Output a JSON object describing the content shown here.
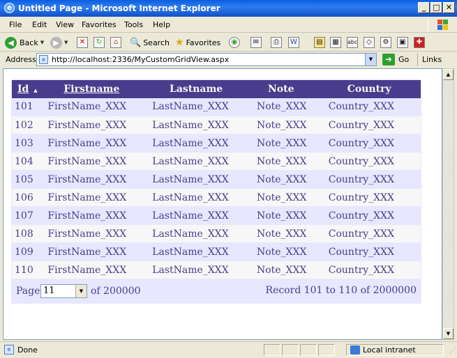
{
  "window": {
    "title": "Untitled Page - Microsoft Internet Explorer",
    "minimize": "_",
    "maximize": "□",
    "close": "✕"
  },
  "menu": [
    "File",
    "Edit",
    "View",
    "Favorites",
    "Tools",
    "Help"
  ],
  "toolbar": {
    "back_label": "Back",
    "search_label": "Search",
    "favorites_label": "Favorites"
  },
  "address": {
    "label": "Address",
    "url": "http://localhost:2336/MyCustomGridView.aspx",
    "go_label": "Go",
    "links_label": "Links"
  },
  "grid": {
    "headers": {
      "id": "Id",
      "sort_indicator": "▲",
      "firstname": "Firstname",
      "lastname": "Lastname",
      "note": "Note",
      "country": "Country"
    },
    "rows": [
      {
        "id": "101",
        "firstname": "FirstName_XXX",
        "lastname": "LastName_XXX",
        "note": "Note_XXX",
        "country": "Country_XXX"
      },
      {
        "id": "102",
        "firstname": "FirstName_XXX",
        "lastname": "LastName_XXX",
        "note": "Note_XXX",
        "country": "Country_XXX"
      },
      {
        "id": "103",
        "firstname": "FirstName_XXX",
        "lastname": "LastName_XXX",
        "note": "Note_XXX",
        "country": "Country_XXX"
      },
      {
        "id": "104",
        "firstname": "FirstName_XXX",
        "lastname": "LastName_XXX",
        "note": "Note_XXX",
        "country": "Country_XXX"
      },
      {
        "id": "105",
        "firstname": "FirstName_XXX",
        "lastname": "LastName_XXX",
        "note": "Note_XXX",
        "country": "Country_XXX"
      },
      {
        "id": "106",
        "firstname": "FirstName_XXX",
        "lastname": "LastName_XXX",
        "note": "Note_XXX",
        "country": "Country_XXX"
      },
      {
        "id": "107",
        "firstname": "FirstName_XXX",
        "lastname": "LastName_XXX",
        "note": "Note_XXX",
        "country": "Country_XXX"
      },
      {
        "id": "108",
        "firstname": "FirstName_XXX",
        "lastname": "LastName_XXX",
        "note": "Note_XXX",
        "country": "Country_XXX"
      },
      {
        "id": "109",
        "firstname": "FirstName_XXX",
        "lastname": "LastName_XXX",
        "note": "Note_XXX",
        "country": "Country_XXX"
      },
      {
        "id": "110",
        "firstname": "FirstName_XXX",
        "lastname": "LastName_XXX",
        "note": "Note_XXX",
        "country": "Country_XXX"
      }
    ],
    "pager": {
      "page_label": "Page",
      "current_page": "11",
      "of_label": "of 200000",
      "record_text": "Record 101 to 110 of 2000000"
    },
    "colors": {
      "header_bg": "#4a3c8c",
      "alt_row_bg": "#e7e7ff",
      "row_bg": "#f7f7f7",
      "text": "#4a3c8c"
    }
  },
  "status": {
    "text": "Done",
    "zone": "Local intranet"
  }
}
